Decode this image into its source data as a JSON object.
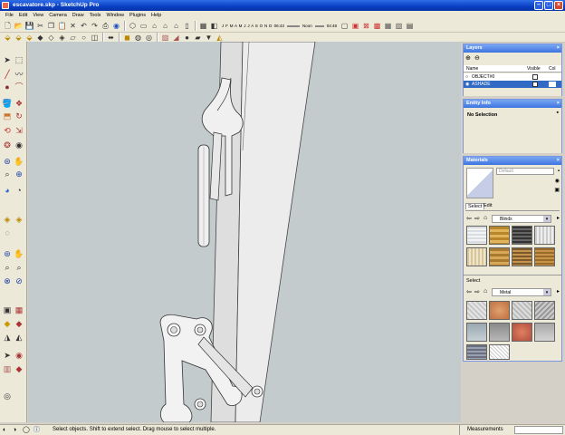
{
  "window": {
    "title": "escavatore.skp - SketchUp Pro"
  },
  "menu": [
    "File",
    "Edit",
    "View",
    "Camera",
    "Draw",
    "Tools",
    "Window",
    "Plugins",
    "Help"
  ],
  "toolbar": {
    "shadow_months": "J F M A M J J A S O N D",
    "time_start": "06:43",
    "time_noon": "Noon",
    "time_end": "04:48"
  },
  "layers": {
    "title": "Layers",
    "headers": {
      "name": "Name",
      "visible": "Visible",
      "color": "Col"
    },
    "rows": [
      {
        "name": "OBJECT#0",
        "selected": false
      },
      {
        "name": "ASHADE",
        "selected": true
      }
    ]
  },
  "entity": {
    "title": "Entity Info",
    "status": "No Selection"
  },
  "materials": {
    "title": "Materials",
    "current": "Default",
    "tabs": {
      "select": "Select",
      "edit": "Edit"
    },
    "library1": "Blinds",
    "section2_label": "Select",
    "library2": "Metal"
  },
  "status": {
    "message": "Select objects. Shift to extend select. Drag mouse to select multiple.",
    "measurements_label": "Measurements"
  },
  "colors": {
    "viewport": "#c4cbcc",
    "title_bar": "#0a3fc2",
    "panel_header": "#3d75e0",
    "selection": "#316ac5"
  }
}
